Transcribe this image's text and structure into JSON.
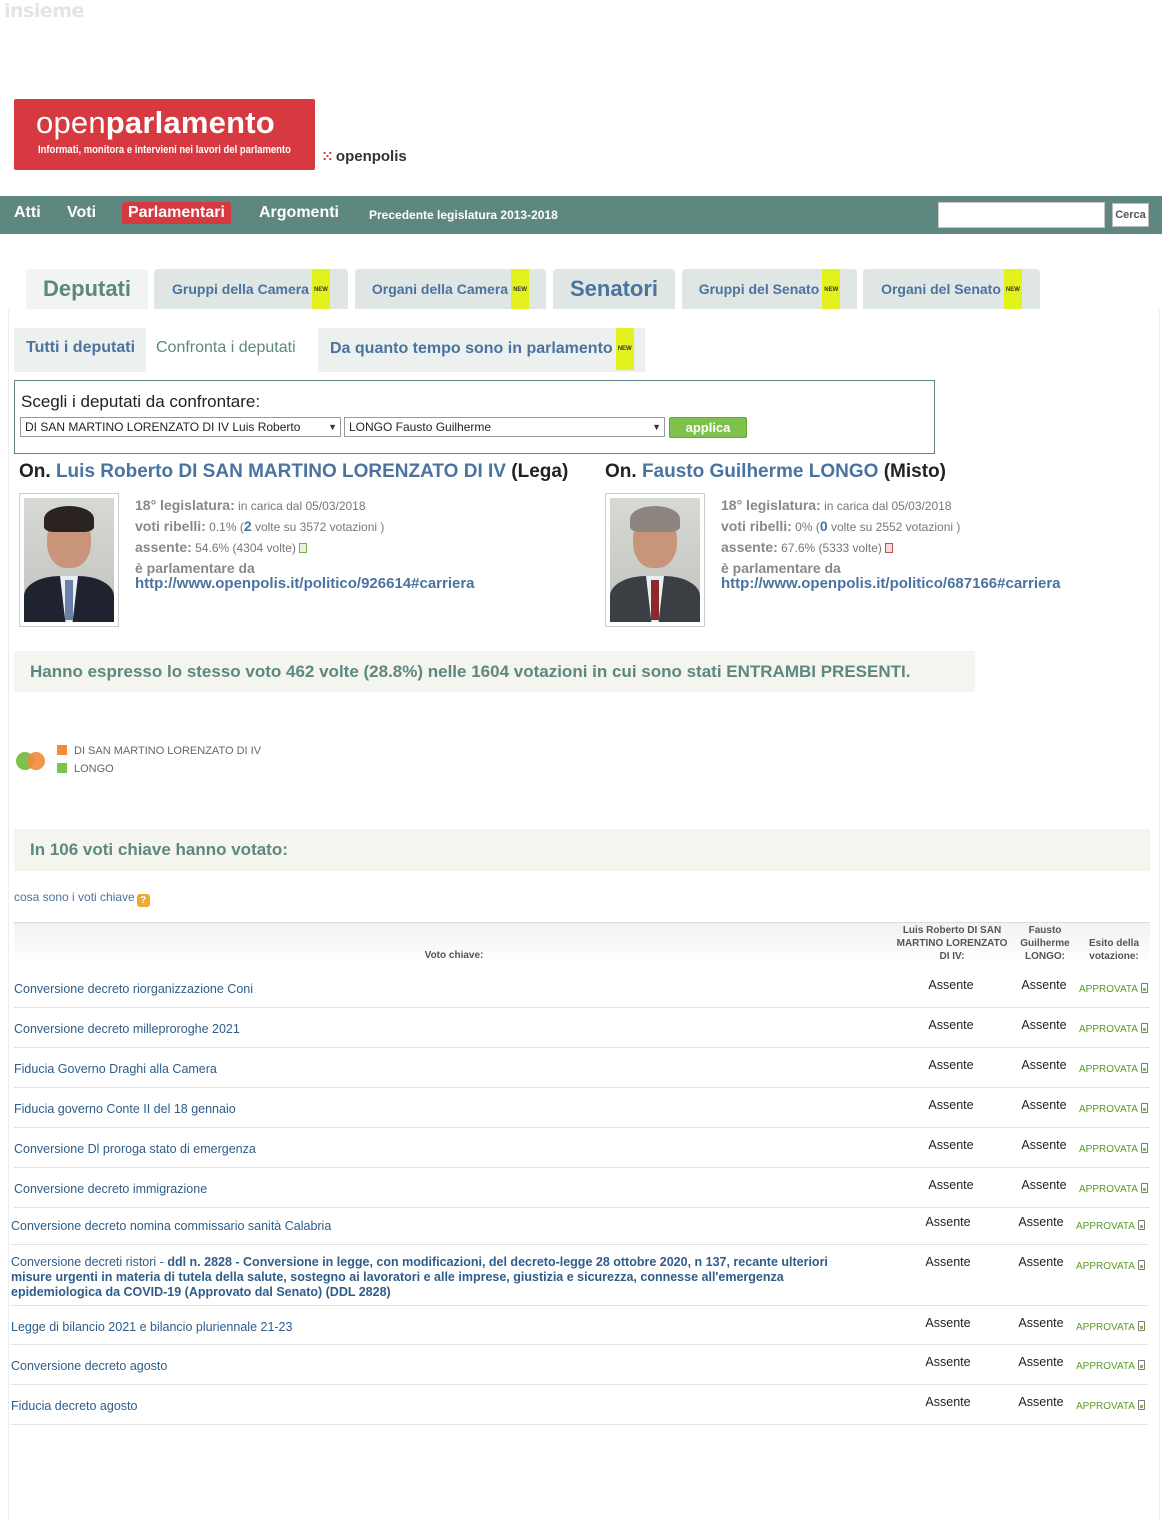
{
  "watermark": "insieme",
  "logo": {
    "title_light": "open",
    "title_bold": "parlamento",
    "subtitle": "Informati, monitora e intervieni nei lavori del parlamento",
    "partner": "openpolis"
  },
  "nav": {
    "items": [
      "Atti",
      "Voti",
      "Parlamentari",
      "Argomenti",
      "Precedente legislatura 2013-2018"
    ],
    "search_placeholder": "",
    "search_button": "Cerca"
  },
  "tabs": {
    "top": [
      "Deputati",
      "Gruppi della Camera",
      "Organi della Camera",
      "Senatori",
      "Gruppi del Senato",
      "Organi del Senato"
    ],
    "new_badge": "NEW",
    "sub": [
      "Tutti i deputati",
      "Confronta i deputati",
      "Da quanto tempo sono in parlamento"
    ]
  },
  "compare": {
    "label": "Scegli i deputati da confrontare:",
    "select1": "DI SAN MARTINO LORENZATO DI IV Luis Roberto",
    "select2": "LONGO Fausto Guilherme",
    "apply": "applica"
  },
  "mps": [
    {
      "prefix": "On.",
      "name": "Luis Roberto DI SAN MARTINO LORENZATO DI IV",
      "party": "(Lega)",
      "legislature_label": "18° legislatura:",
      "legislature_value": "in carica dal 05/03/2018",
      "rebel_label": "voti ribelli:",
      "rebel_pct": "0.1% (",
      "rebel_count": "2",
      "rebel_rest": " volte su 3572 votazioni )",
      "absent_label": "assente:",
      "absent_value": "54.6% (4304 volte)",
      "since_label": "è parlamentare da",
      "url": "http://www.openpolis.it/politico/926614#carriera"
    },
    {
      "prefix": "On.",
      "name": "Fausto Guilherme LONGO",
      "party": "(Misto)",
      "legislature_label": "18° legislatura:",
      "legislature_value": "in carica dal 05/03/2018",
      "rebel_label": "voti ribelli:",
      "rebel_pct": "0% (",
      "rebel_count": "0",
      "rebel_rest": " volte su 2552 votazioni )",
      "absent_label": "assente:",
      "absent_value": "67.6% (5333 volte)",
      "since_label": "è parlamentare da",
      "url": "http://www.openpolis.it/politico/687166#carriera"
    }
  ],
  "same_vote": "Hanno espresso lo stesso voto 462 volte (28.8%) nelle 1604 votazioni in cui sono stati ENTRAMBI PRESENTI.",
  "legend": [
    "DI SAN MARTINO LORENZATO DI IV",
    "LONGO"
  ],
  "colors": {
    "nav_bg": "#5e8780",
    "brand_red": "#d6393f",
    "legend_1": "#f08b3c",
    "legend_2": "#7dc24c"
  },
  "key_votes": {
    "title": "In 106 voti chiave hanno votato:",
    "link": "cosa sono i voti chiave",
    "headers": {
      "voto": "Voto chiave:",
      "mp1": "Luis Roberto DI SAN MARTINO LORENZATO DI IV:",
      "mp2": "Fausto Guilherme LONGO:",
      "esito": "Esito della votazione:"
    },
    "rows": [
      {
        "title": "Conversione decreto riorganizzazione Coni",
        "v1": "Assente",
        "v2": "Assente",
        "esito": "APPROVATA"
      },
      {
        "title": "Conversione decreto milleproroghe 2021",
        "v1": "Assente",
        "v2": "Assente",
        "esito": "APPROVATA"
      },
      {
        "title": "Fiducia Governo Draghi alla Camera",
        "v1": "Assente",
        "v2": "Assente",
        "esito": "APPROVATA"
      },
      {
        "title": "Fiducia governo Conte II del 18 gennaio",
        "v1": "Assente",
        "v2": "Assente",
        "esito": "APPROVATA"
      },
      {
        "title": "Conversione Dl proroga stato di emergenza",
        "v1": "Assente",
        "v2": "Assente",
        "esito": "APPROVATA"
      },
      {
        "title": "Conversione decreto immigrazione",
        "v1": "Assente",
        "v2": "Assente",
        "esito": "APPROVATA"
      },
      {
        "title": "Conversione decreto nomina commissario sanità Calabria",
        "v1": "Assente",
        "v2": "Assente",
        "esito": "APPROVATA"
      },
      {
        "title": "Conversione decreti ristori - ",
        "title_bold": "ddl n. 2828 - Conversione in legge, con modificazioni, del decreto-legge 28 ottobre 2020, n 137, recante ulteriori misure urgenti in materia di tutela della salute, sostegno ai lavoratori e alle imprese, giustizia e sicurezza, connesse all'emergenza epidemiologica da COVID-19 (Approvato dal Senato) (DDL 2828)",
        "v1": "Assente",
        "v2": "Assente",
        "esito": "APPROVATA"
      },
      {
        "title": "Legge di bilancio 2021 e bilancio pluriennale 21-23",
        "v1": "Assente",
        "v2": "Assente",
        "esito": "APPROVATA"
      },
      {
        "title": "Conversione decreto agosto",
        "v1": "Assente",
        "v2": "Assente",
        "esito": "APPROVATA"
      },
      {
        "title": "Fiducia decreto agosto",
        "v1": "Assente",
        "v2": "Assente",
        "esito": "APPROVATA"
      }
    ]
  }
}
